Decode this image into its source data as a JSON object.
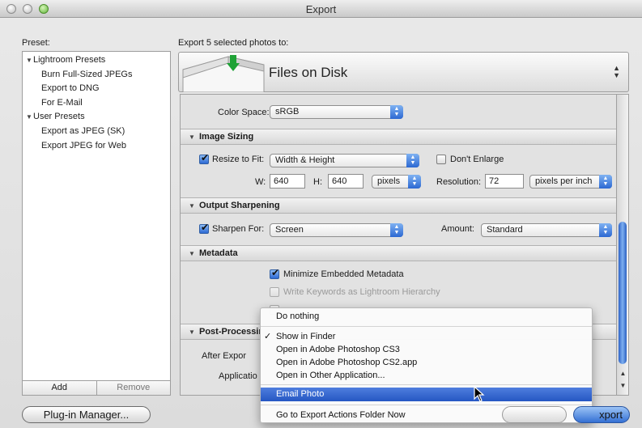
{
  "window": {
    "title": "Export"
  },
  "presets": {
    "label": "Preset:",
    "tree": [
      {
        "type": "group",
        "label": "Lightroom Presets"
      },
      {
        "type": "item",
        "label": "Burn Full-Sized JPEGs"
      },
      {
        "type": "item",
        "label": "Export to DNG"
      },
      {
        "type": "item",
        "label": "For E-Mail"
      },
      {
        "type": "group",
        "label": "User Presets"
      },
      {
        "type": "item",
        "label": "Export as JPEG (SK)"
      },
      {
        "type": "item",
        "label": "Export JPEG for Web"
      }
    ],
    "add_label": "Add",
    "remove_label": "Remove"
  },
  "export": {
    "header": "Export 5 selected photos to:",
    "destination": "Files on Disk"
  },
  "file_settings": {
    "color_space_label": "Color Space:",
    "color_space_value": "sRGB"
  },
  "image_sizing": {
    "title": "Image Sizing",
    "resize_label": "Resize to Fit:",
    "resize_checked": true,
    "resize_mode": "Width & Height",
    "dont_enlarge_label": "Don't Enlarge",
    "dont_enlarge_checked": false,
    "w_label": "W:",
    "w_value": "640",
    "h_label": "H:",
    "h_value": "640",
    "units": "pixels",
    "resolution_label": "Resolution:",
    "resolution_value": "72",
    "resolution_units": "pixels per inch"
  },
  "output_sharpening": {
    "title": "Output Sharpening",
    "sharpen_label": "Sharpen For:",
    "sharpen_checked": true,
    "sharpen_value": "Screen",
    "amount_label": "Amount:",
    "amount_value": "Standard"
  },
  "metadata": {
    "title": "Metadata",
    "minimize_label": "Minimize Embedded Metadata",
    "minimize_checked": true,
    "keywords_label": "Write Keywords as Lightroom Hierarchy",
    "keywords_checked": false
  },
  "post_processing": {
    "title": "Post-Processir",
    "after_export_label": "After Expor",
    "application_label": "Applicatio"
  },
  "menu": {
    "items": [
      {
        "label": "Do nothing",
        "checked": false,
        "selected": false
      },
      {
        "label": "Show in Finder",
        "checked": true,
        "selected": false
      },
      {
        "label": "Open in Adobe Photoshop CS3",
        "checked": false,
        "selected": false
      },
      {
        "label": "Open in Adobe Photoshop CS2.app",
        "checked": false,
        "selected": false
      },
      {
        "label": "Open in Other Application...",
        "checked": false,
        "selected": false
      },
      {
        "label": "Email Photo",
        "checked": false,
        "selected": true
      },
      {
        "label": "Go to Export Actions Folder Now",
        "checked": false,
        "selected": false
      }
    ]
  },
  "footer": {
    "plugin_manager_label": "Plug-in Manager...",
    "export_label": "xport"
  },
  "colors": {
    "accent": "#2d69d3",
    "menu_highlight": "#3463cf",
    "window_bg": "#e2e2e2"
  },
  "icons": [
    "disk-export-icon",
    "disclosure-triangle-icon",
    "stepper-icon",
    "checkmark-icon",
    "pointer-cursor-icon"
  ]
}
